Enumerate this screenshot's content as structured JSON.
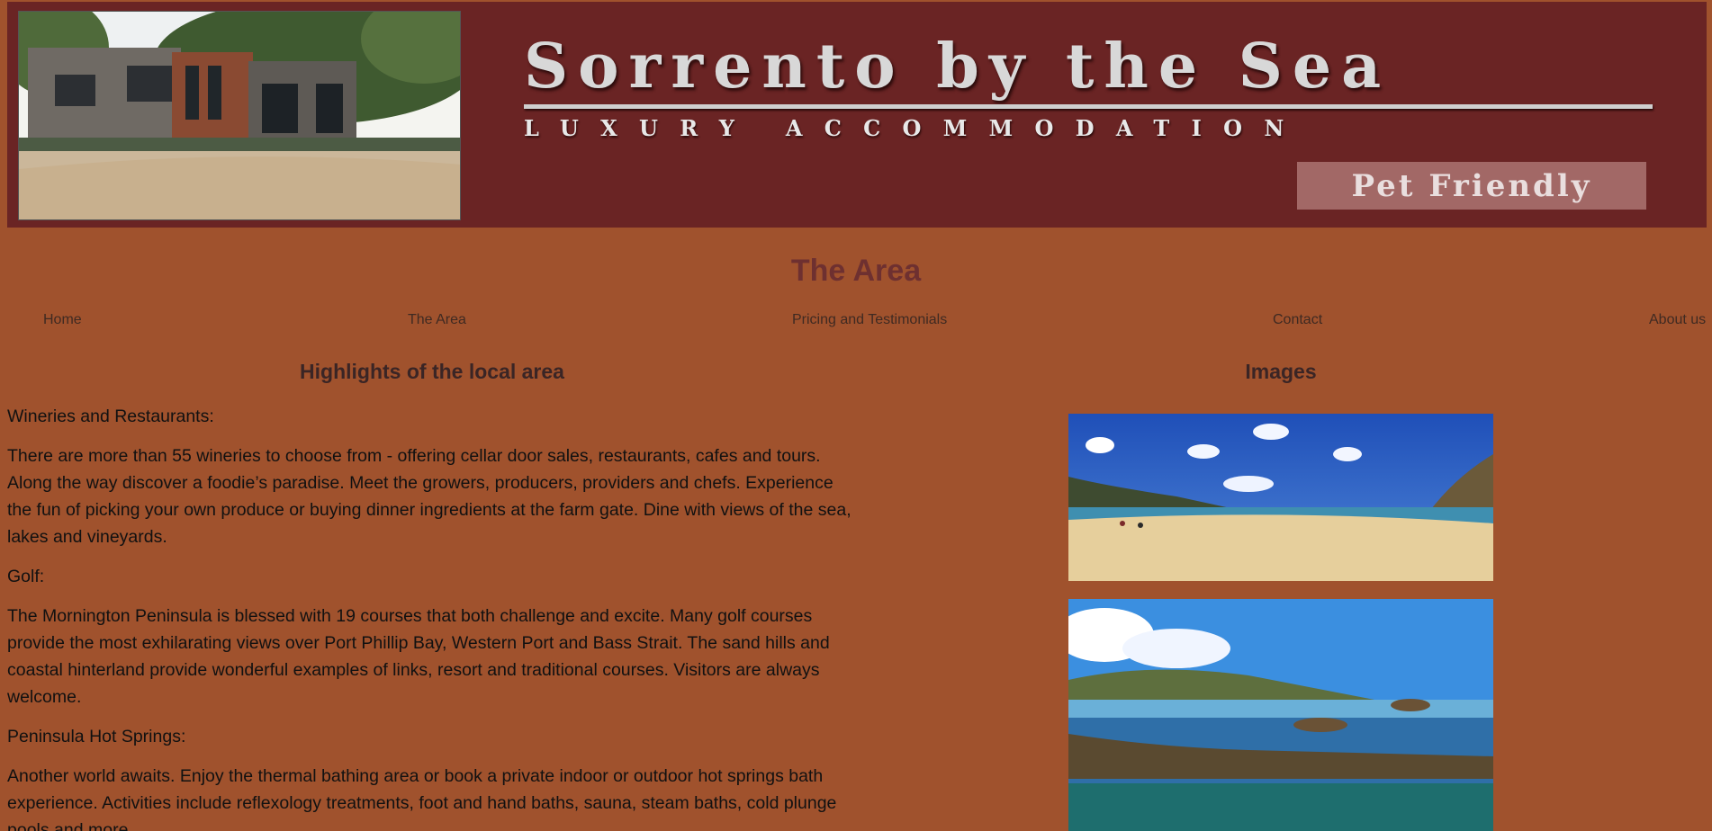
{
  "header": {
    "title": "Sorrento by the Sea",
    "subtitle": "LUXURY ACCOMMODATION",
    "pet_label": "Pet Friendly"
  },
  "page_title": "The Area",
  "nav": [
    {
      "label": "Home"
    },
    {
      "label": "The Area"
    },
    {
      "label": "Pricing and Testimonials"
    },
    {
      "label": "Contact"
    },
    {
      "label": "About us"
    }
  ],
  "highlights": {
    "heading": "Highlights of the local area",
    "paragraphs": [
      "Wineries and Restaurants:",
      "There are more than 55 wineries to choose from - offering cellar door sales, restaurants, cafes and tours. Along the way discover a foodie’s paradise. Meet the growers, producers, providers and chefs. Experience the fun of picking your own produce or buying dinner ingredients at the farm gate. Dine with views of the sea, lakes and vineyards.",
      "Golf:",
      "The Mornington Peninsula is blessed with 19 courses that both challenge and excite. Many golf courses provide the most exhilarating views over Port Phillip Bay, Western Port and Bass Strait. The sand hills and coastal hinterland provide wonderful examples of links, resort and traditional courses. Visitors are always welcome.",
      "Peninsula Hot Springs:",
      "Another world awaits. Enjoy the thermal bathing area or book a private indoor or outdoor hot springs bath experience. Activities include reflexology treatments, foot and hand baths, sauna, steam baths, cold plunge pools and more."
    ]
  },
  "images": {
    "heading": "Images"
  },
  "colors": {
    "page_bg": "#a0522d",
    "banner_bg": "#6a2424",
    "title_color": "#6e3030"
  }
}
